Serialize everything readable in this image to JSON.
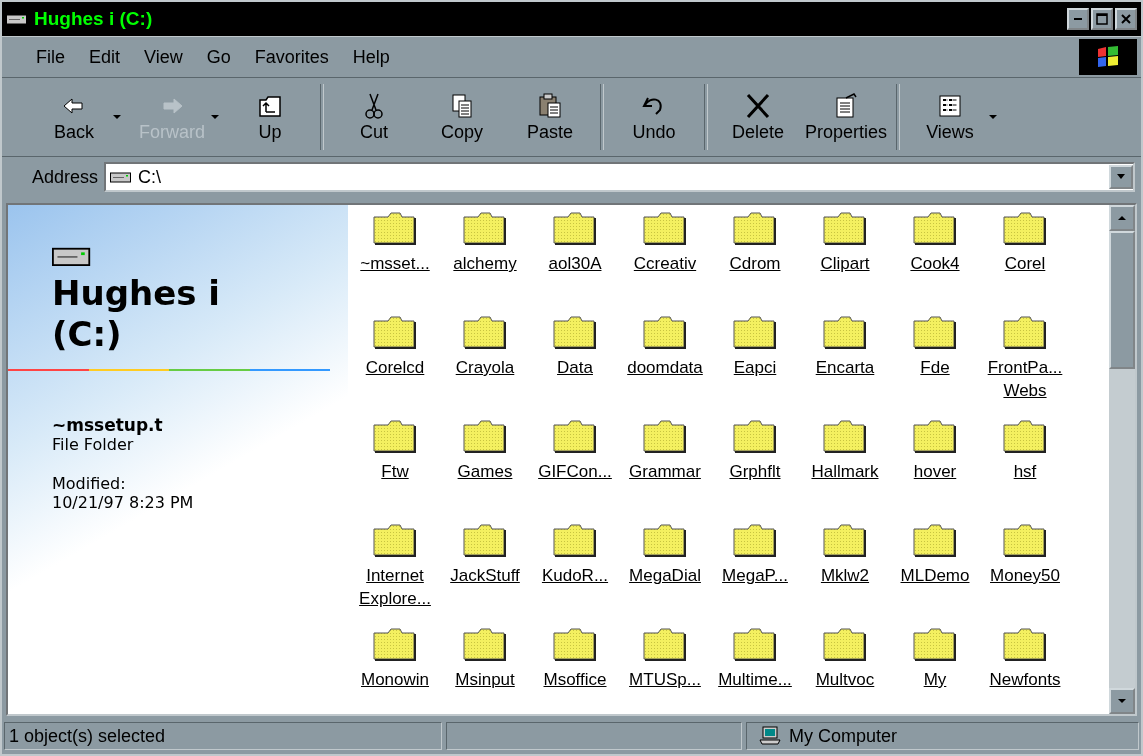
{
  "window": {
    "title": "Hughes i (C:)"
  },
  "menu": [
    "File",
    "Edit",
    "View",
    "Go",
    "Favorites",
    "Help"
  ],
  "toolbar": [
    {
      "label": "Back",
      "disabled": false,
      "dropdown": true
    },
    {
      "label": "Forward",
      "disabled": true,
      "dropdown": true
    },
    {
      "label": "Up",
      "disabled": false,
      "dropdown": false
    },
    {
      "label": "Cut",
      "disabled": false,
      "dropdown": false
    },
    {
      "label": "Copy",
      "disabled": false,
      "dropdown": false
    },
    {
      "label": "Paste",
      "disabled": false,
      "dropdown": false
    },
    {
      "label": "Undo",
      "disabled": false,
      "dropdown": false
    },
    {
      "label": "Delete",
      "disabled": false,
      "dropdown": false
    },
    {
      "label": "Properties",
      "disabled": false,
      "dropdown": false
    },
    {
      "label": "Views",
      "disabled": false,
      "dropdown": true
    }
  ],
  "address": {
    "label": "Address",
    "value": "C:\\"
  },
  "info_panel": {
    "title": "Hughes i (C:)",
    "item_name": "~mssetup.t",
    "item_type": "File Folder",
    "modified_label": "Modified:",
    "modified": "10/21/97 8:23 PM"
  },
  "folders": [
    "~msset...",
    "alchemy",
    "aol30A",
    "Ccreativ",
    "Cdrom",
    "Clipart",
    "Cook4",
    "Corel",
    "Corelcd",
    "Crayola",
    "Data",
    "doomdata",
    "Eapci",
    "Encarta",
    "Fde",
    "FrontPa... Webs",
    "Ftw",
    "Games",
    "GIFCon...",
    "Grammar",
    "Grphflt",
    "Hallmark",
    "hover",
    "hsf",
    "Internet Explore...",
    "JackStuff",
    "KudoR...",
    "MegaDial",
    "MegaP...",
    "Mklw2",
    "MLDemo",
    "Money50",
    "Monowin",
    "Msinput",
    "Msoffice",
    "MTUSp...",
    "Multime...",
    "Multvoc",
    "My",
    "Newfonts"
  ],
  "status_bar": {
    "selection": "1 object(s) selected",
    "zone": "My Computer"
  }
}
